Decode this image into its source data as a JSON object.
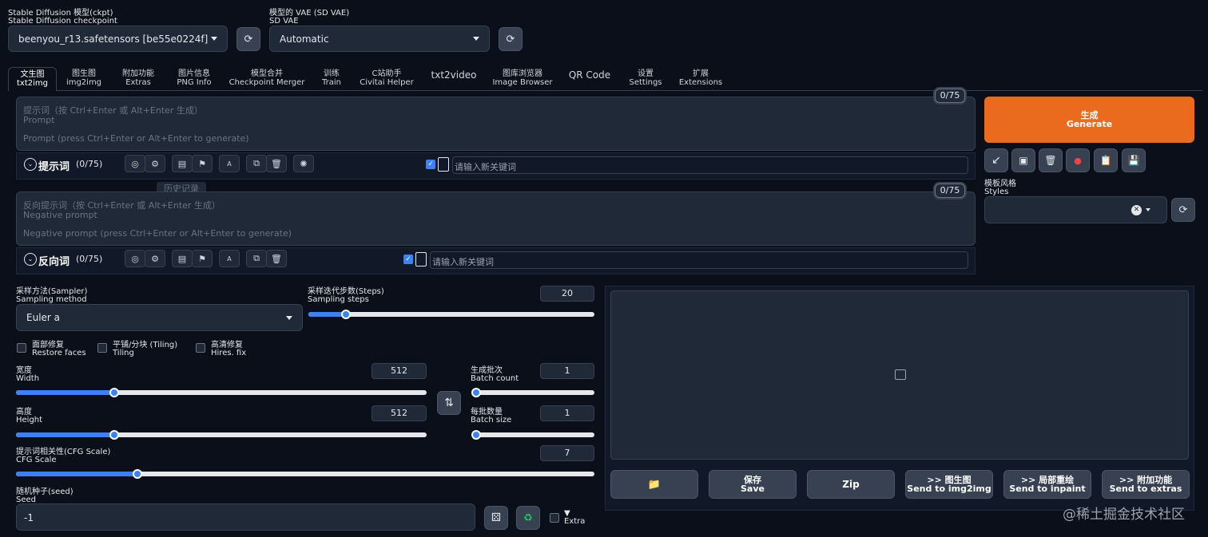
{
  "checkpoint": {
    "label_cn": "Stable Diffusion 模型(ckpt)",
    "label_en": "Stable Diffusion checkpoint",
    "value": "beenyou_r13.safetensors [be55e0224f]"
  },
  "vae": {
    "label_cn": "模型的 VAE (SD VAE)",
    "label_en": "SD VAE",
    "value": "Automatic"
  },
  "tabs": [
    {
      "cn": "文生图",
      "en": "txt2img"
    },
    {
      "cn": "图生图",
      "en": "img2img"
    },
    {
      "cn": "附加功能",
      "en": "Extras"
    },
    {
      "cn": "图片信息",
      "en": "PNG Info"
    },
    {
      "cn": "模型合并",
      "en": "Checkpoint Merger"
    },
    {
      "cn": "训练",
      "en": "Train"
    },
    {
      "cn": "C站助手",
      "en": "Civitai Helper"
    },
    {
      "cn": "txt2video",
      "en": ""
    },
    {
      "cn": "图库浏览器",
      "en": "Image Browser"
    },
    {
      "cn": "QR Code",
      "en": ""
    },
    {
      "cn": "设置",
      "en": "Settings"
    },
    {
      "cn": "扩展",
      "en": "Extensions"
    }
  ],
  "prompt": {
    "counter": "0/75",
    "label_cn": "提示词（按 Ctrl+Enter 或 Alt+Enter 生成）",
    "label_en": "Prompt",
    "placeholder": "Prompt (press Ctrl+Enter or Alt+Enter to generate)",
    "section": "提示词",
    "section_count": "(0/75)",
    "keyword_placeholder": "请输入新关键词",
    "tooltip": "历史记录"
  },
  "negative": {
    "counter": "0/75",
    "label_cn": "反向提示词（按 Ctrl+Enter 或 Alt+Enter 生成）",
    "label_en": "Negative prompt",
    "placeholder": "Negative prompt (press Ctrl+Enter or Alt+Enter to generate)",
    "section": "反向词",
    "section_count": "(0/75)",
    "keyword_placeholder": "请输入新关键词"
  },
  "generate": {
    "cn": "生成",
    "en": "Generate"
  },
  "styles": {
    "cn": "模板风格",
    "en": "Styles"
  },
  "sampler": {
    "label_cn": "采样方法(Sampler)",
    "label_en": "Sampling method",
    "value": "Euler a"
  },
  "steps": {
    "label_cn": "采样迭代步数(Steps)",
    "label_en": "Sampling steps",
    "value": "20",
    "fraction": 0.13
  },
  "restore_faces": {
    "cn": "面部修复",
    "en": "Restore faces"
  },
  "tiling": {
    "cn": "平铺/分块 (Tiling)",
    "en": "Tiling"
  },
  "hires": {
    "cn": "高清修复",
    "en": "Hires. fix"
  },
  "width": {
    "cn": "宽度",
    "en": "Width",
    "value": "512",
    "fraction": 0.24
  },
  "height": {
    "cn": "高度",
    "en": "Height",
    "value": "512",
    "fraction": 0.24
  },
  "batch_count": {
    "cn": "生成批次",
    "en": "Batch count",
    "value": "1",
    "fraction": 0
  },
  "batch_size": {
    "cn": "每批数量",
    "en": "Batch size",
    "value": "1",
    "fraction": 0
  },
  "cfg": {
    "cn": "提示词相关性(CFG Scale)",
    "en": "CFG Scale",
    "value": "7",
    "fraction": 0.21
  },
  "seed": {
    "cn": "随机种子(seed)",
    "en": "Seed",
    "value": "-1"
  },
  "extra": {
    "arrow": "▼",
    "label": "Extra"
  },
  "output_buttons": {
    "save": {
      "cn": "保存",
      "en": "Save"
    },
    "zip": "Zip",
    "img2img": {
      "cn": ">> 图生图",
      "en": "Send to img2img"
    },
    "inpaint": {
      "cn": ">> 局部重绘",
      "en": "Send to inpaint"
    },
    "extras": {
      "cn": ">> 附加功能",
      "en": "Send to extras"
    }
  },
  "watermark": "@稀土掘金技术社区",
  "colors": {
    "accent": "#ea6b1e",
    "slider": "#3b82f6",
    "bg": "#0b0f19"
  }
}
